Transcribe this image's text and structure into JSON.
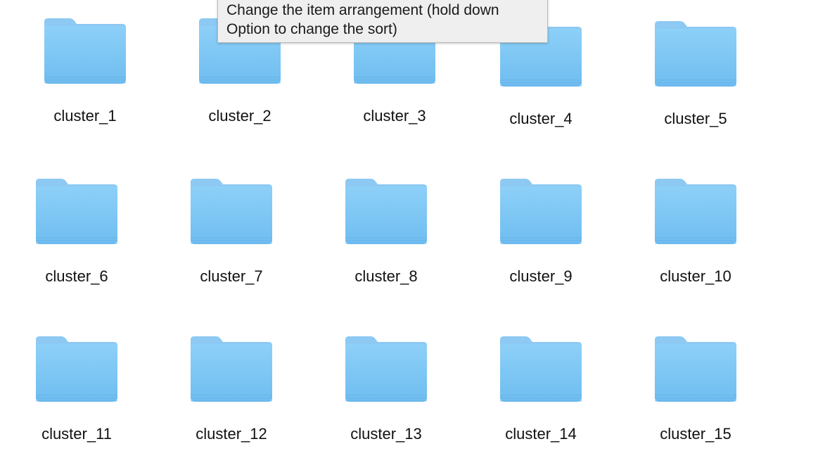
{
  "tooltip": {
    "line1": "Change the item arrangement (hold down",
    "line2": "Option to change the sort)"
  },
  "folder_colors": {
    "tab": "#8dc9f3",
    "body_top": "#8dd0f8",
    "body_bottom": "#6fbdf0",
    "stripe": "#66b3ea"
  },
  "folders": [
    {
      "name": "cluster_1",
      "icon": "folder-icon"
    },
    {
      "name": "cluster_2",
      "icon": "folder-icon"
    },
    {
      "name": "cluster_3",
      "icon": "folder-icon"
    },
    {
      "name": "cluster_4",
      "icon": "folder-icon"
    },
    {
      "name": "cluster_5",
      "icon": "folder-icon"
    },
    {
      "name": "cluster_6",
      "icon": "folder-icon"
    },
    {
      "name": "cluster_7",
      "icon": "folder-icon"
    },
    {
      "name": "cluster_8",
      "icon": "folder-icon"
    },
    {
      "name": "cluster_9",
      "icon": "folder-icon"
    },
    {
      "name": "cluster_10",
      "icon": "folder-icon"
    },
    {
      "name": "cluster_11",
      "icon": "folder-icon"
    },
    {
      "name": "cluster_12",
      "icon": "folder-icon"
    },
    {
      "name": "cluster_13",
      "icon": "folder-icon"
    },
    {
      "name": "cluster_14",
      "icon": "folder-icon"
    },
    {
      "name": "cluster_15",
      "icon": "folder-icon"
    }
  ]
}
